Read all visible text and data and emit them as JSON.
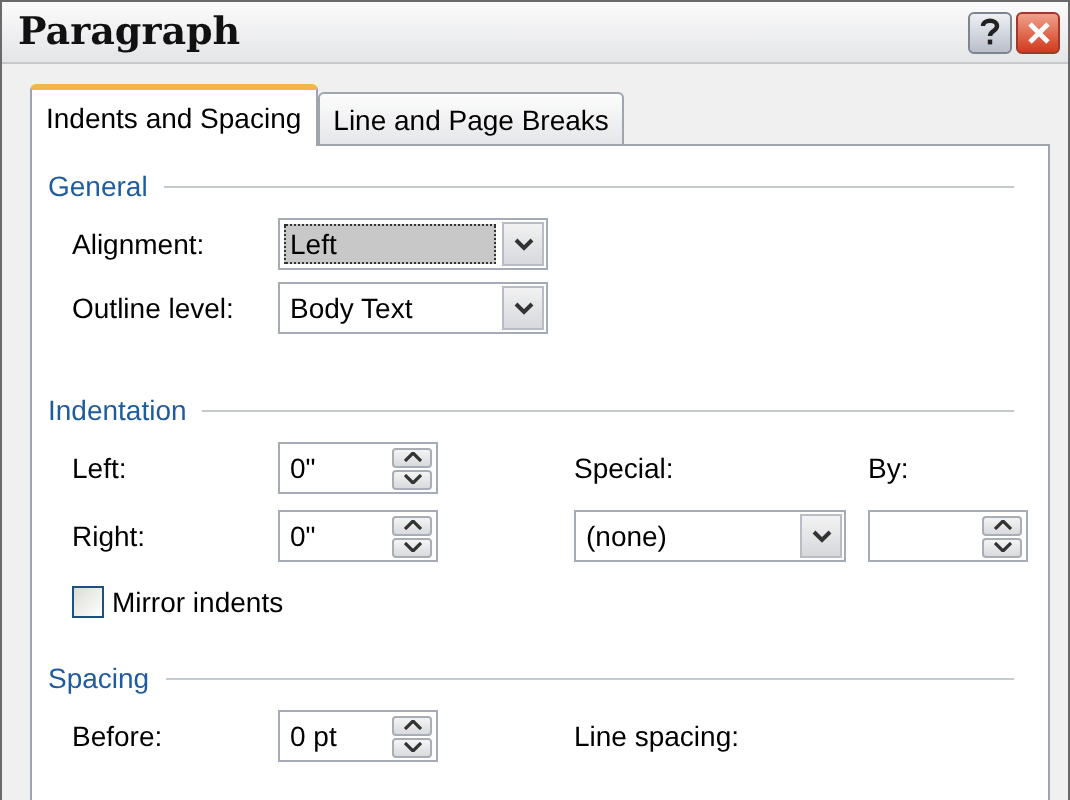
{
  "window": {
    "title": "Paragraph"
  },
  "tabs": [
    {
      "label": "Indents and Spacing",
      "selected": true
    },
    {
      "label": "Line and Page Breaks",
      "selected": false
    }
  ],
  "general": {
    "title": "General",
    "alignment": {
      "label": "Alignment:",
      "value": "Left",
      "focused": true
    },
    "outline_level": {
      "label": "Outline level:",
      "value": "Body Text",
      "focused": false
    }
  },
  "indentation": {
    "title": "Indentation",
    "left": {
      "label": "Left:",
      "value": "0\""
    },
    "right": {
      "label": "Right:",
      "value": "0\""
    },
    "special": {
      "label": "Special:",
      "value": "(none)",
      "focused": false
    },
    "by": {
      "label": "By:"
    },
    "mirror_indents": {
      "label": "Mirror indents",
      "checked": false
    }
  },
  "spacing": {
    "title": "Spacing",
    "before": {
      "label": "Before:",
      "value": "0 pt"
    },
    "line_spacing": {
      "label": "Line spacing:"
    }
  }
}
